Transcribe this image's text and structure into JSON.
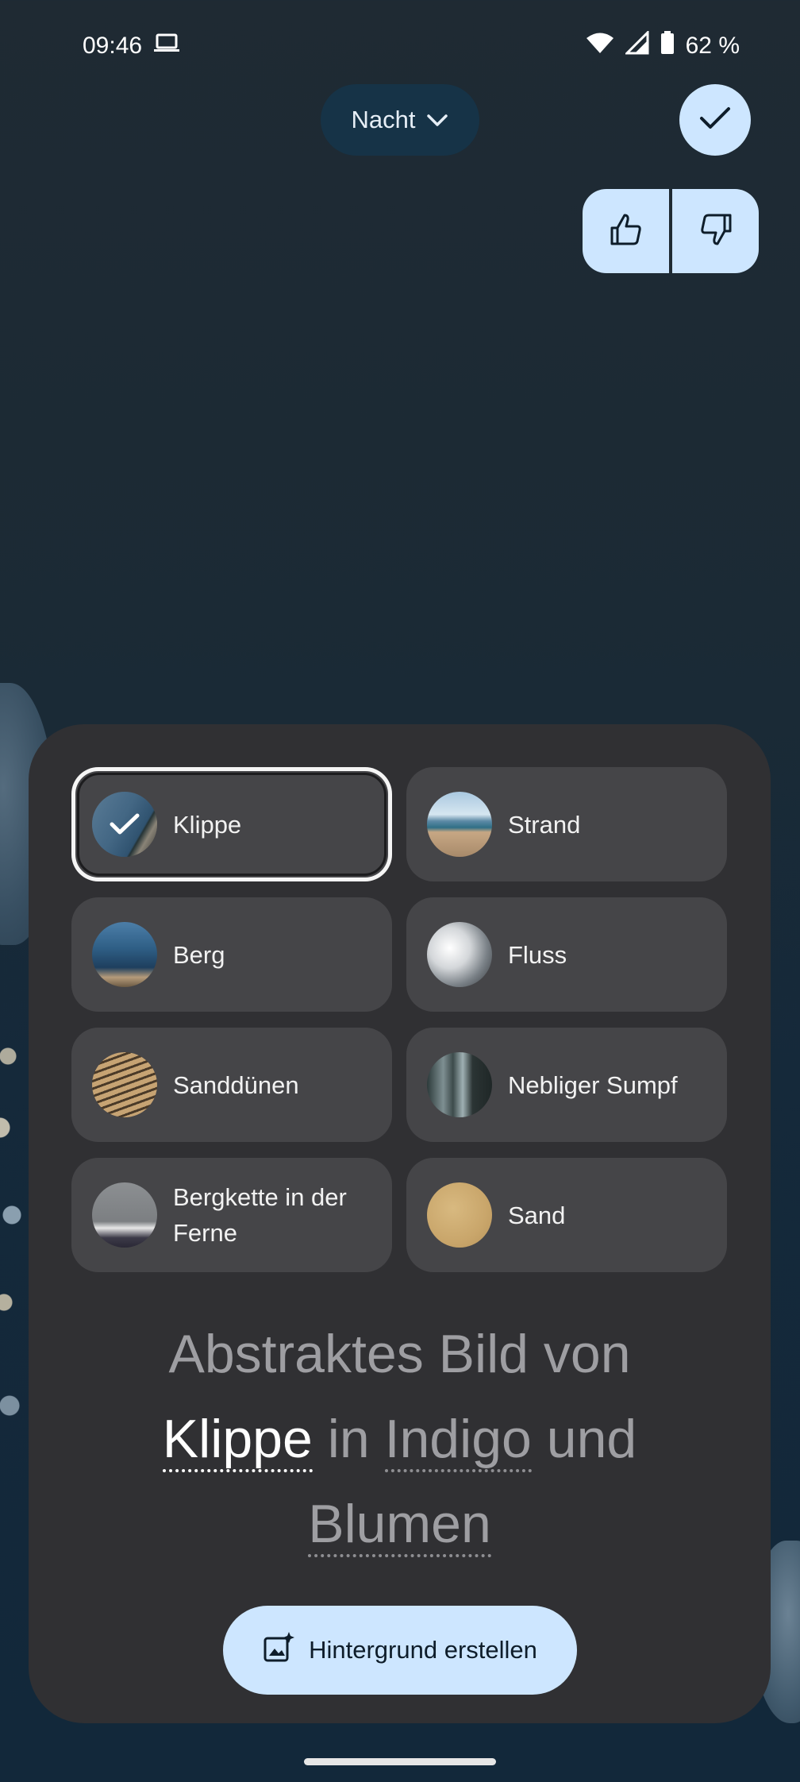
{
  "status_bar": {
    "time": "09:46",
    "battery": "62 %",
    "icons": [
      "laptop-icon",
      "wifi-icon",
      "signal-icon",
      "battery-icon"
    ]
  },
  "header": {
    "mode_label": "Nacht",
    "mode_icon": "chevron-down-icon",
    "confirm_icon": "check-icon",
    "feedback": {
      "like_icon": "thumb-up-icon",
      "dislike_icon": "thumb-down-icon"
    }
  },
  "subjects": [
    {
      "label": "Klippe",
      "selected": true
    },
    {
      "label": "Strand",
      "selected": false
    },
    {
      "label": "Berg",
      "selected": false
    },
    {
      "label": "Fluss",
      "selected": false
    },
    {
      "label": "Sanddünen",
      "selected": false
    },
    {
      "label": "Nebliger Sumpf",
      "selected": false
    },
    {
      "label": "Bergkette in der Ferne",
      "selected": false
    },
    {
      "label": "Sand",
      "selected": false
    }
  ],
  "prompt": {
    "prefix": "Abstraktes Bild von",
    "subject": "Klippe",
    "connector_in": "in",
    "color": "Indigo",
    "connector_and": "und",
    "element": "Blumen"
  },
  "action": {
    "create_label": "Hintergrund erstellen",
    "create_icon": "image-sparkle-icon"
  },
  "colors": {
    "accent": "#cde6ff",
    "sheet": "#303033",
    "chip": "#454548"
  }
}
